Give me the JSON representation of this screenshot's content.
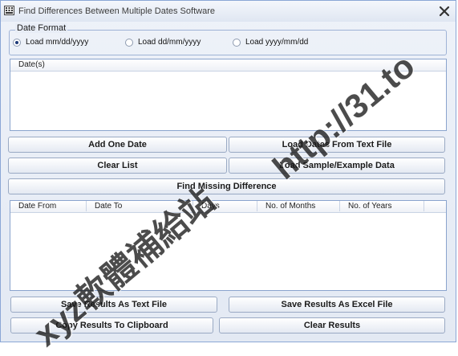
{
  "window": {
    "title": "Find Differences Between Multiple Dates Software",
    "close_symbol": "✕"
  },
  "date_format": {
    "legend": "Date Format",
    "options": [
      {
        "label": "Load mm/dd/yyyy",
        "selected": true
      },
      {
        "label": "Load dd/mm/yyyy",
        "selected": false
      },
      {
        "label": "Load yyyy/mm/dd",
        "selected": false
      }
    ]
  },
  "dates_list": {
    "header": "Date(s)",
    "items": []
  },
  "buttons": {
    "add_one_date": "Add One Date",
    "load_dates_from_file": "Load Dates From  Text File",
    "clear_list": "Clear List",
    "load_sample": "Load Sample/Example Data",
    "find_difference": "Find Missing Difference",
    "save_text": "Save Results As  Text File",
    "save_excel": "Save Results As Excel File",
    "copy_clipboard": "Copy Results  To Clipboard",
    "clear_results": "Clear Results"
  },
  "results_table": {
    "columns": [
      "Date From",
      "Date To",
      "Days",
      "No. of Months",
      "No. of Years"
    ],
    "rows": []
  },
  "watermark": {
    "line1": "xyz軟體補給站",
    "line2": "http://31.to"
  }
}
